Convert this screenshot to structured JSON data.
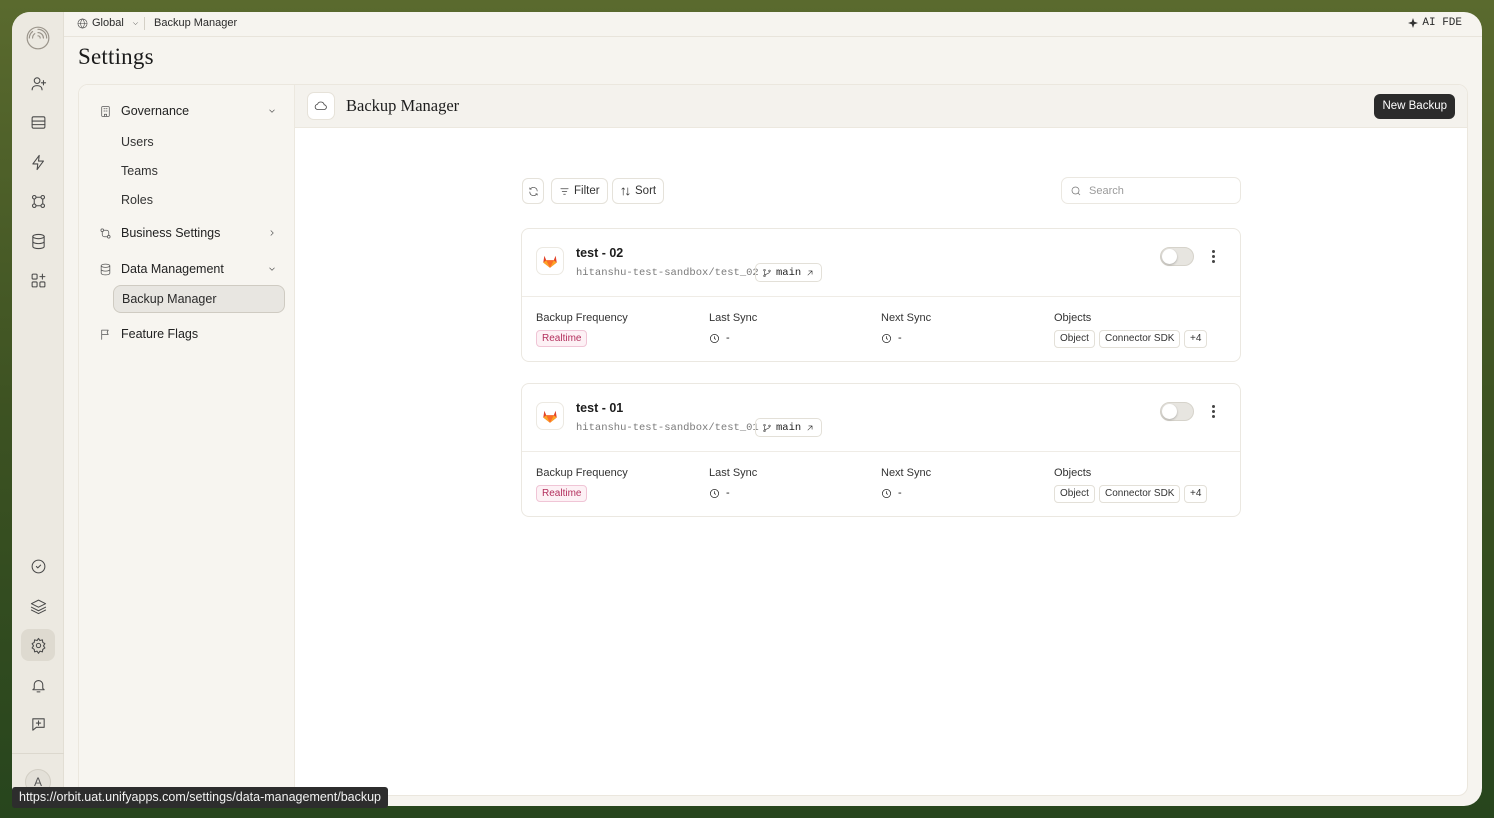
{
  "topbar": {
    "scope": "Global",
    "breadcrumb": "Backup Manager",
    "ai_button": "AI FDE"
  },
  "page": {
    "title": "Settings"
  },
  "sidebar": {
    "groups": [
      {
        "label": "Governance",
        "items": [
          "Users",
          "Teams",
          "Roles"
        ]
      },
      {
        "label": "Business Settings"
      },
      {
        "label": "Data Management",
        "items": [
          "Backup Manager"
        ]
      },
      {
        "label": "Feature Flags"
      }
    ],
    "active_item": "Backup Manager"
  },
  "main": {
    "title": "Backup Manager",
    "new_button": "New Backup",
    "toolbar": {
      "filter": "Filter",
      "sort": "Sort",
      "search_placeholder": "Search"
    },
    "labels": {
      "frequency": "Backup Frequency",
      "last_sync": "Last Sync",
      "next_sync": "Next Sync",
      "objects": "Objects"
    },
    "backups": [
      {
        "name": "test - 02",
        "repo": "hitanshu-test-sandbox/test_02",
        "branch": "main",
        "frequency": "Realtime",
        "last_sync": "-",
        "next_sync": "-",
        "objects": [
          "Object",
          "Connector SDK",
          "+4"
        ],
        "enabled": false
      },
      {
        "name": "test - 01",
        "repo": "hitanshu-test-sandbox/test_01",
        "branch": "main",
        "frequency": "Realtime",
        "last_sync": "-",
        "next_sync": "-",
        "objects": [
          "Object",
          "Connector SDK",
          "+4"
        ],
        "enabled": false
      }
    ]
  },
  "user": {
    "avatar_initial": "A"
  },
  "status_url": "https://orbit.uat.unifyapps.com/settings/data-management/backup",
  "colors": {
    "dark_button": "#2b2b2b",
    "realtime_text": "#b3305d",
    "realtime_bg": "#fdf1f5"
  }
}
